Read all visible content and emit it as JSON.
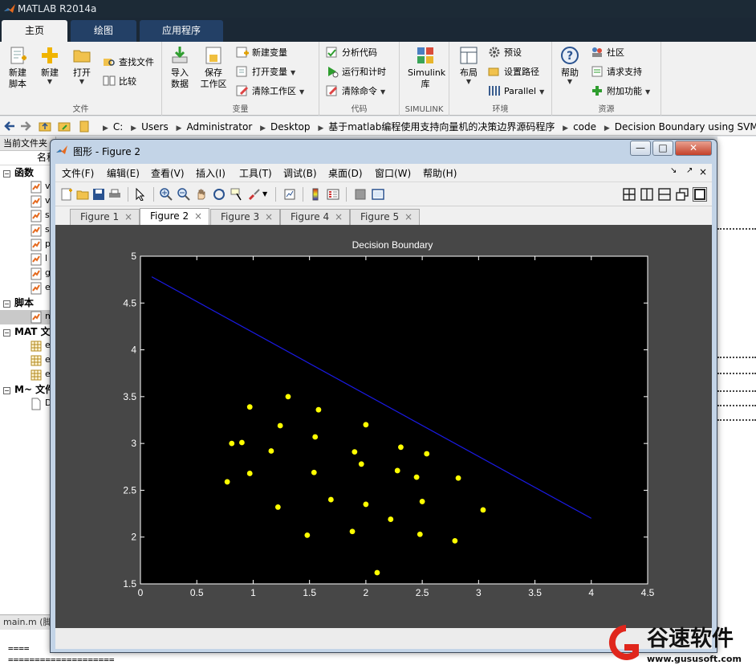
{
  "app": {
    "title": "MATLAB R2014a"
  },
  "ribbon_tabs": [
    {
      "label": "主页",
      "active": true
    },
    {
      "label": "绘图",
      "active": false
    },
    {
      "label": "应用程序",
      "active": false
    }
  ],
  "ribbon": {
    "groups": {
      "file": "文件",
      "variable": "变量",
      "code": "代码",
      "simulink": "SIMULINK",
      "environment": "环境",
      "resources": "资源"
    },
    "new_script": [
      "新建",
      "脚本"
    ],
    "new": "新建",
    "open": "打开",
    "find_files": "查找文件",
    "compare": "比较",
    "import_data": [
      "导入",
      "数据"
    ],
    "save_workspace": [
      "保存",
      "工作区"
    ],
    "new_variable": "新建变量",
    "open_variable": "打开变量",
    "clear_workspace": "清除工作区",
    "analyze_code": "分析代码",
    "run_and_time": "运行和计时",
    "clear_commands": "清除命令",
    "simulink_library": [
      "Simulink",
      "库"
    ],
    "layout": "布局",
    "preferences": "预设",
    "set_path": "设置路径",
    "parallel": "Parallel",
    "help": "帮助",
    "community": "社区",
    "request_support": "请求支持",
    "add_ons": "附加功能"
  },
  "address_bar": {
    "crumbs": [
      "C:",
      "Users",
      "Administrator",
      "Desktop",
      "基于matlab编程使用支持向量机的决策边界源码程序",
      "code",
      "Decision Boundary using SVMs"
    ]
  },
  "left_panel": {
    "header": "当前文件夹",
    "column_name": "名称",
    "sections": {
      "functions": "函数",
      "scripts": "脚本",
      "mat_files": "MAT 文件",
      "m_files": "M~ 文件"
    },
    "function_items": [
      "v",
      "v",
      "s",
      "s",
      "p",
      "l",
      "g",
      "e"
    ],
    "script_items": [
      "m"
    ],
    "mat_items": [
      "e",
      "e",
      "e"
    ],
    "m_items": [
      "D"
    ]
  },
  "detail_panel": {
    "header": "main.m (脚本)",
    "lines": [
      "==== ",
      "===================="
    ]
  },
  "figure_window": {
    "title": "图形 - Figure 2",
    "menu": [
      "文件(F)",
      "编辑(E)",
      "查看(V)",
      "插入(I)",
      "工具(T)",
      "调试(B)",
      "桌面(D)",
      "窗口(W)",
      "帮助(H)"
    ],
    "menu_right": [
      "↘",
      "↗",
      "×"
    ],
    "tabs": [
      {
        "label": "Figure 1",
        "active": false
      },
      {
        "label": "Figure 2",
        "active": true
      },
      {
        "label": "Figure 3",
        "active": false
      },
      {
        "label": "Figure 4",
        "active": false
      },
      {
        "label": "Figure 5",
        "active": false
      }
    ],
    "tab_close": "×",
    "controls": {
      "minimize": "—",
      "maximize": "□",
      "close": "✕"
    }
  },
  "chart_data": {
    "type": "scatter",
    "title": "Decision Boundary",
    "xlabel": "",
    "ylabel": "",
    "xlim": [
      0,
      4.5
    ],
    "ylim": [
      1.5,
      5
    ],
    "xticks": [
      0,
      0.5,
      1,
      1.5,
      2,
      2.5,
      3,
      3.5,
      4,
      4.5
    ],
    "yticks": [
      1.5,
      2,
      2.5,
      3,
      3.5,
      4,
      4.5,
      5
    ],
    "grid": false,
    "colors": {
      "axes_bg": "#000000",
      "figure_bg": "#474747",
      "points": "#ffff00",
      "boundary": "#1a1ae6",
      "ticks": "#ffffff"
    },
    "points": [
      [
        0.77,
        2.59
      ],
      [
        0.81,
        3.0
      ],
      [
        0.9,
        3.01
      ],
      [
        0.97,
        3.39
      ],
      [
        0.97,
        2.68
      ],
      [
        1.16,
        2.92
      ],
      [
        1.22,
        2.32
      ],
      [
        1.24,
        3.19
      ],
      [
        1.31,
        3.5
      ],
      [
        1.48,
        2.02
      ],
      [
        1.54,
        2.69
      ],
      [
        1.55,
        3.07
      ],
      [
        1.58,
        3.36
      ],
      [
        1.69,
        2.4
      ],
      [
        1.88,
        2.06
      ],
      [
        1.9,
        2.91
      ],
      [
        1.96,
        2.78
      ],
      [
        2.0,
        3.2
      ],
      [
        2.0,
        2.35
      ],
      [
        2.1,
        1.62
      ],
      [
        2.22,
        2.19
      ],
      [
        2.28,
        2.71
      ],
      [
        2.31,
        2.96
      ],
      [
        2.45,
        2.64
      ],
      [
        2.48,
        2.03
      ],
      [
        2.5,
        2.38
      ],
      [
        2.54,
        2.89
      ],
      [
        2.79,
        1.96
      ],
      [
        2.82,
        2.63
      ],
      [
        3.04,
        2.29
      ]
    ],
    "boundary_line": {
      "x": [
        0.1,
        4.0
      ],
      "y": [
        4.78,
        2.2
      ]
    }
  }
}
